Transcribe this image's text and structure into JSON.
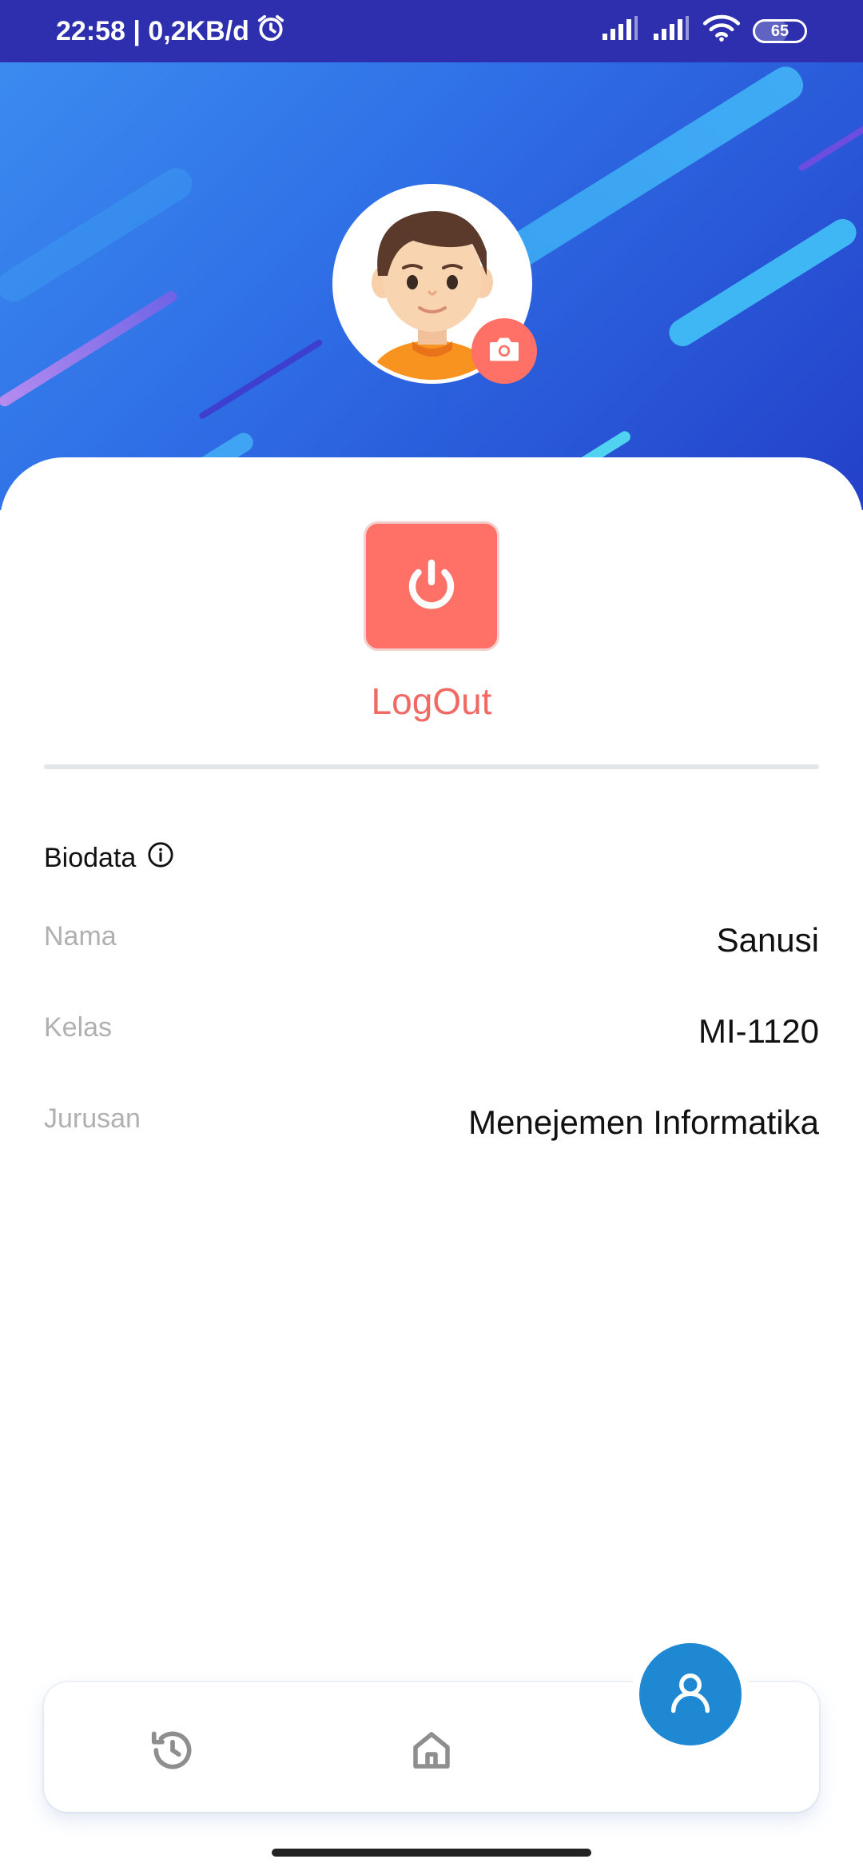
{
  "status_bar": {
    "time_data": "22:58 | 0,2KB/d",
    "battery": "65"
  },
  "profile": {
    "logout_label": "LogOut"
  },
  "biodata": {
    "title": "Biodata",
    "rows": [
      {
        "label": "Nama",
        "value": "Sanusi"
      },
      {
        "label": "Kelas",
        "value": "MI-1120"
      },
      {
        "label": "Jurusan",
        "value": "Menejemen Informatika"
      }
    ]
  },
  "colors": {
    "status_bar": "#2d2fae",
    "accent_red": "#ff7167",
    "fab_blue": "#1e88d2"
  },
  "icons": {
    "status": [
      "alarm-icon",
      "signal-icon",
      "signal-icon",
      "wifi-icon",
      "battery-icon"
    ],
    "nav": [
      "history-icon",
      "home-icon",
      "profile-icon"
    ]
  }
}
